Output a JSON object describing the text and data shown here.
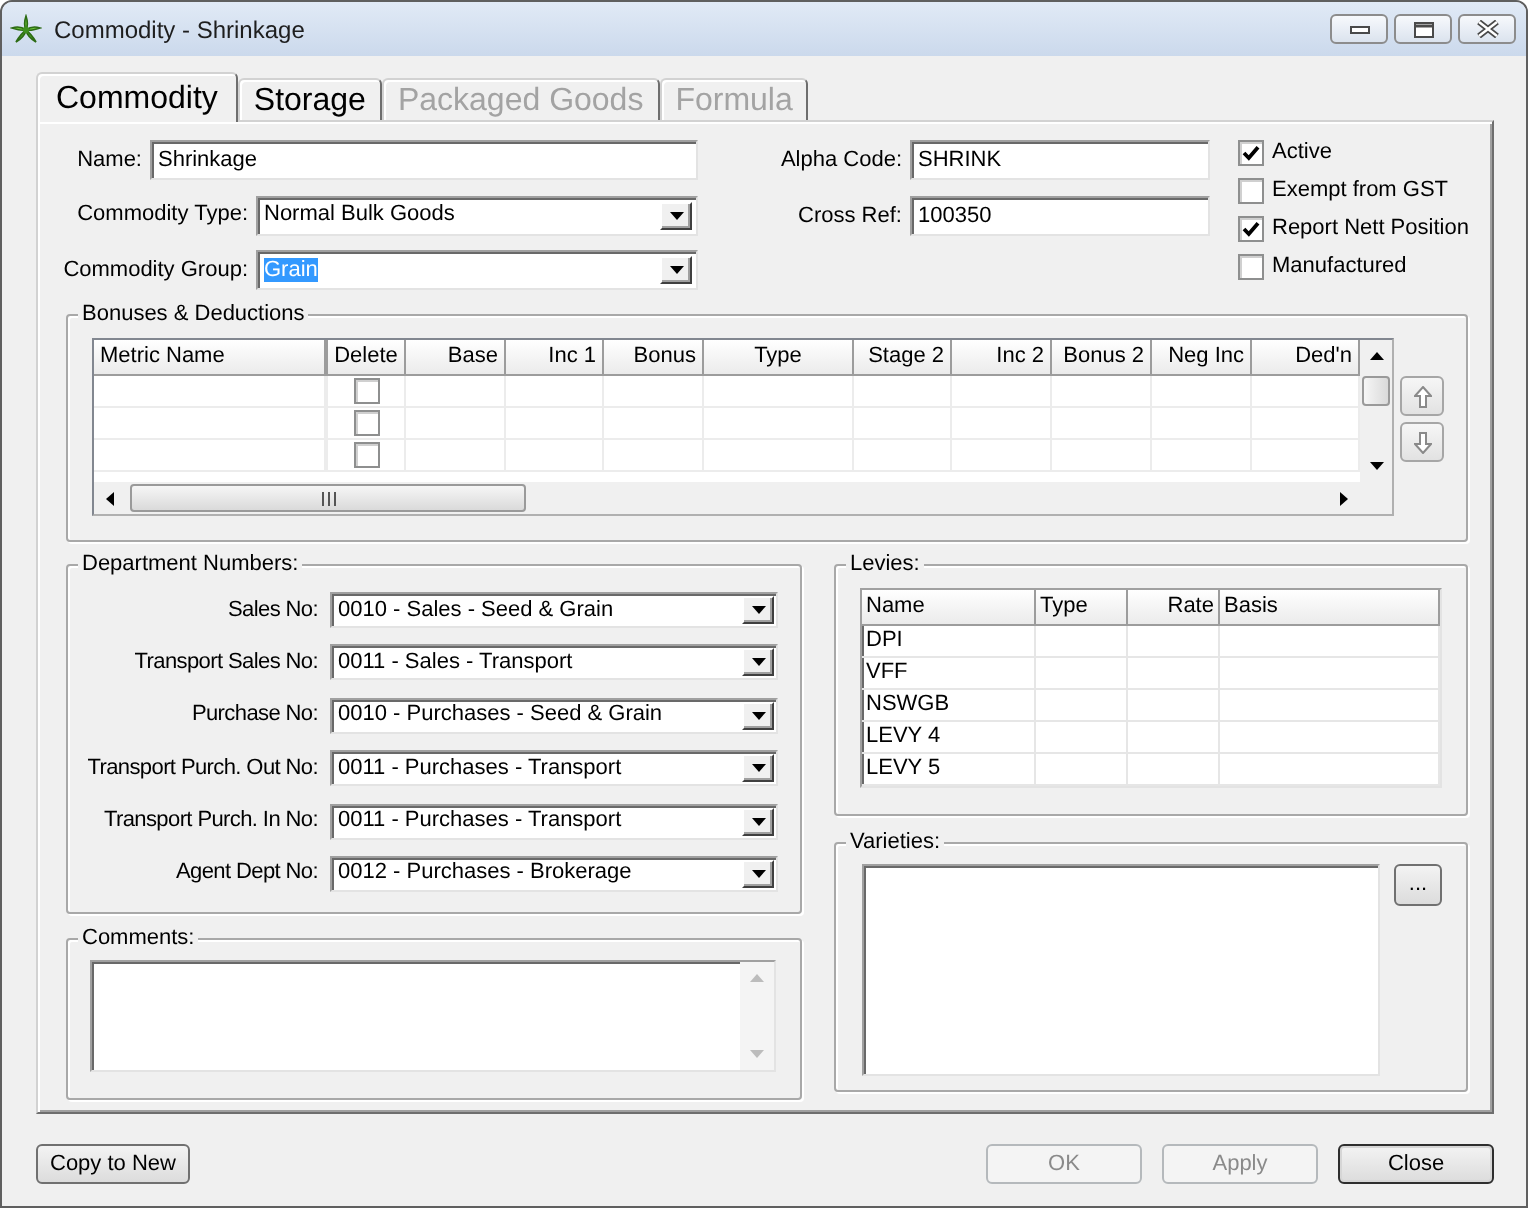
{
  "window": {
    "title": "Commodity - Shrinkage"
  },
  "tabs": [
    {
      "label": "Commodity",
      "selected": true,
      "disabled": false
    },
    {
      "label": "Storage",
      "selected": false,
      "disabled": false
    },
    {
      "label": "Packaged Goods",
      "selected": false,
      "disabled": true
    },
    {
      "label": "Formula",
      "selected": false,
      "disabled": true
    }
  ],
  "details": {
    "left": [
      {
        "label": "Name:",
        "value": "Shrinkage",
        "kind": "text",
        "text_selected": false
      },
      {
        "label": "Commodity Type:",
        "value": "Normal Bulk Goods",
        "kind": "dropdown",
        "text_selected": false
      },
      {
        "label": "Commodity Group:",
        "value": "Grain",
        "kind": "dropdown",
        "text_selected": true
      }
    ],
    "right": [
      {
        "label": "Alpha Code:",
        "value": "SHRINK",
        "kind": "text",
        "text_selected": false
      },
      {
        "label": "Cross Ref:",
        "value": "100350",
        "kind": "text",
        "text_selected": false
      }
    ]
  },
  "options": [
    {
      "label": "Active",
      "checked": true
    },
    {
      "label": "Exempt from GST",
      "checked": false
    },
    {
      "label": "Report Nett Position",
      "checked": true
    },
    {
      "label": "Manufactured",
      "checked": false
    }
  ],
  "bonuses": {
    "title": "Bonuses & Deductions",
    "columns": [
      {
        "label": "Metric Name",
        "kind": "text"
      },
      {
        "label": "Delete",
        "kind": "checkbox"
      },
      {
        "label": "Base",
        "kind": "number"
      },
      {
        "label": "Inc 1",
        "kind": "number"
      },
      {
        "label": "Bonus",
        "kind": "number"
      },
      {
        "label": "Type",
        "kind": "choice"
      },
      {
        "label": "Stage 2",
        "kind": "number"
      },
      {
        "label": "Inc 2",
        "kind": "number"
      },
      {
        "label": "Bonus 2",
        "kind": "number"
      },
      {
        "label": "Neg Inc",
        "kind": "number"
      },
      {
        "label": "Ded'n",
        "kind": "number"
      }
    ],
    "rows": [
      {
        "checked": false
      },
      {
        "checked": false
      },
      {
        "checked": false
      }
    ]
  },
  "departments": {
    "title": "Department Numbers:",
    "rows": [
      {
        "label": "Sales No:",
        "value": "0010 - Sales - Seed & Grain"
      },
      {
        "label": "Transport Sales No:",
        "value": "0011 - Sales - Transport"
      },
      {
        "label": "Purchase No:",
        "value": "0010 - Purchases - Seed & Grain"
      },
      {
        "label": "Transport Purch. Out No:",
        "value": "0011 - Purchases - Transport"
      },
      {
        "label": "Transport Purch. In No:",
        "value": "0011 - Purchases - Transport"
      },
      {
        "label": "Agent Dept No:",
        "value": "0012 - Purchases - Brokerage"
      }
    ]
  },
  "comments": {
    "title": "Comments:"
  },
  "levies": {
    "title": "Levies:",
    "columns": [
      {
        "label": "Name",
        "kind": "text"
      },
      {
        "label": "Type",
        "kind": "text"
      },
      {
        "label": "Rate",
        "kind": "number"
      },
      {
        "label": "Basis",
        "kind": "text"
      }
    ],
    "rows": [
      {
        "name": "DPI"
      },
      {
        "name": "VFF"
      },
      {
        "name": "NSWGB"
      },
      {
        "name": "LEVY 4"
      },
      {
        "name": "LEVY 5"
      }
    ]
  },
  "varieties": {
    "title": "Varieties:",
    "button": "..."
  },
  "footer": {
    "left": [
      {
        "label": "Copy to New",
        "disabled": false,
        "default": false
      }
    ],
    "right": [
      {
        "label": "OK",
        "disabled": true,
        "default": false
      },
      {
        "label": "Apply",
        "disabled": true,
        "default": false
      },
      {
        "label": "Close",
        "disabled": false,
        "default": true
      }
    ]
  }
}
